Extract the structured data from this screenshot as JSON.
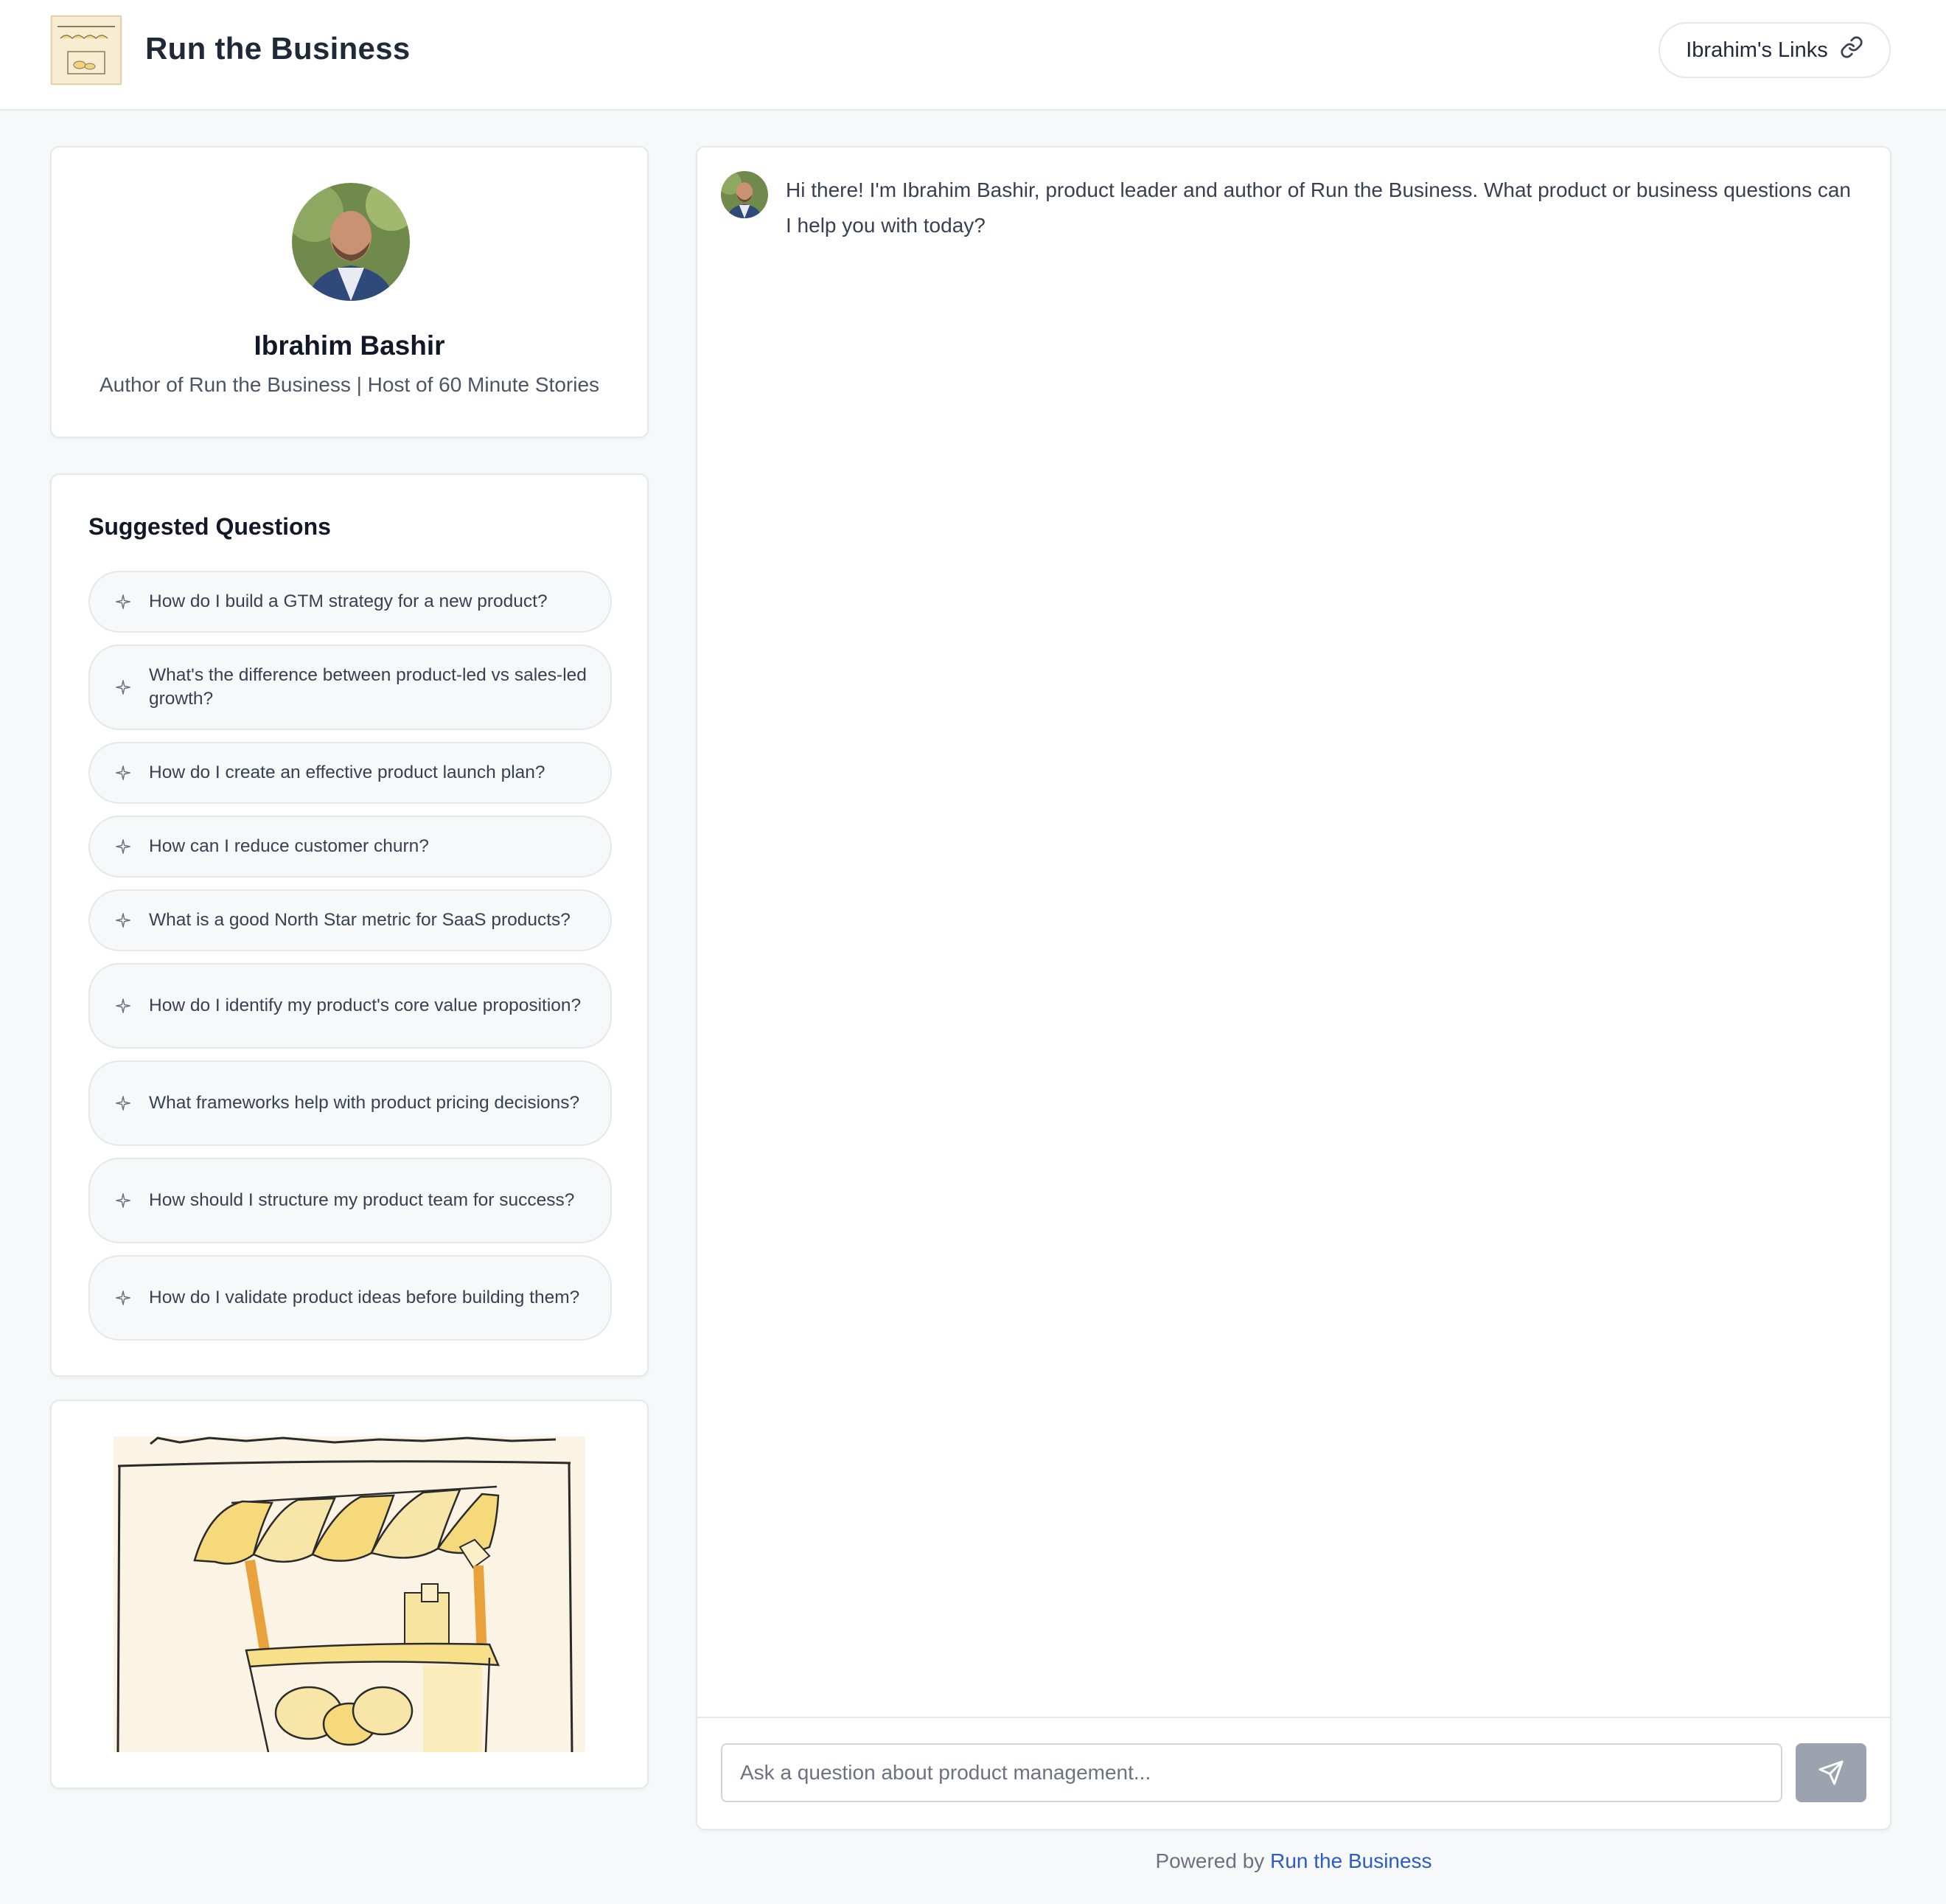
{
  "header": {
    "title": "Run the Business",
    "links_button": "Ibrahim's Links"
  },
  "profile": {
    "name": "Ibrahim Bashir",
    "tagline": "Author of Run the Business | Host of 60 Minute Stories"
  },
  "suggested": {
    "title": "Suggested Questions",
    "questions": [
      "How do I build a GTM strategy for a new product?",
      "What's the difference between product-led vs sales-led growth?",
      "How do I create an effective product launch plan?",
      "How can I reduce customer churn?",
      "What is a good North Star metric for SaaS products?",
      "How do I identify my product's core value proposition?",
      "What frameworks help with product pricing decisions?",
      "How should I structure my product team for success?",
      "How do I validate product ideas before building them?"
    ]
  },
  "chat": {
    "greeting": "Hi there! I'm Ibrahim Bashir, product leader and author of Run the Business. What product or business questions can I help you with today?",
    "input_placeholder": "Ask a question about product management..."
  },
  "footer": {
    "prefix": "Powered by",
    "link": "Run the Business",
    "link_color": "#2b5cc9"
  },
  "icons": {
    "links": "link-icon",
    "question": "sparkle-icon",
    "send": "send-icon"
  }
}
